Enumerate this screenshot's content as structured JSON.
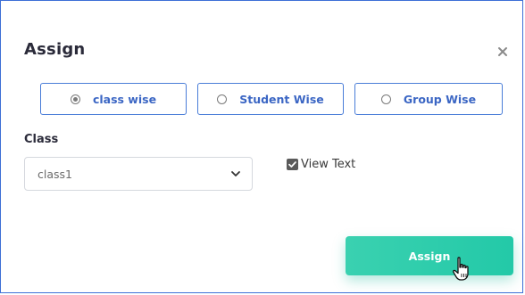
{
  "modal": {
    "title": "Assign",
    "close_icon": "close-icon"
  },
  "assign_type": {
    "options": [
      {
        "label": "class wise",
        "checked": true
      },
      {
        "label": "Student Wise",
        "checked": false
      },
      {
        "label": "Group Wise",
        "checked": false
      }
    ]
  },
  "class_field": {
    "label": "Class",
    "selected_value": "class1",
    "icon": "chevron-down-icon"
  },
  "view_text": {
    "label": "View Text",
    "checked": true
  },
  "actions": {
    "assign_label": "Assign",
    "cursor_icon": "hand-pointer-icon"
  },
  "colors": {
    "border_accent": "#3d6fd6",
    "radio_text": "#3b66c4",
    "button_bg": "#2ccca9"
  }
}
